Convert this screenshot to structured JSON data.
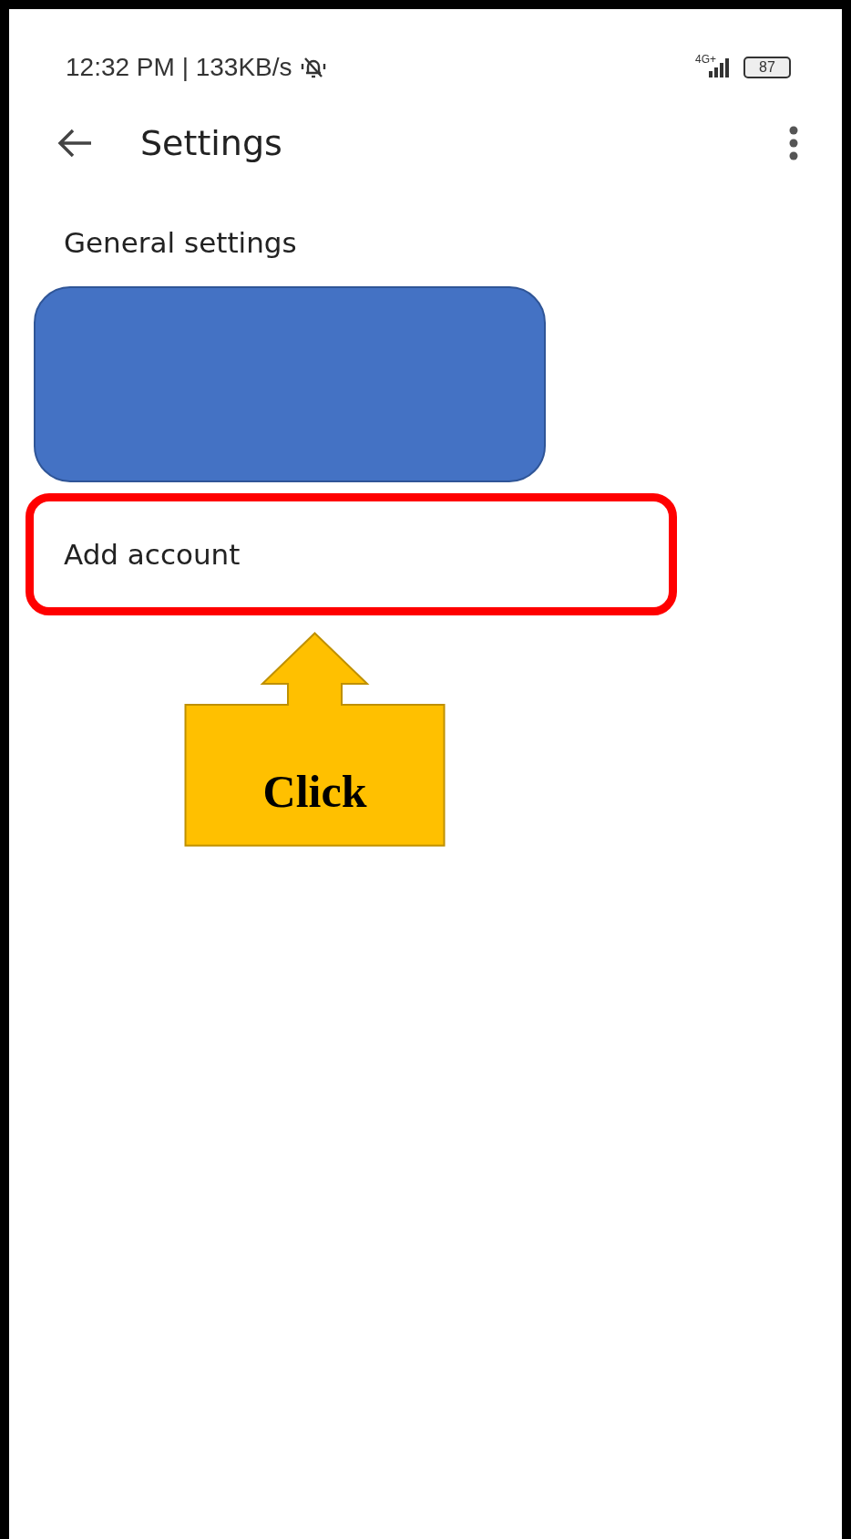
{
  "status_bar": {
    "time": "12:32 PM | 133KB/s",
    "network": "4G+",
    "battery": "87"
  },
  "app_bar": {
    "title": "Settings"
  },
  "sections": [
    {
      "kind": "item",
      "label": "General settings"
    },
    {
      "kind": "redacted"
    },
    {
      "kind": "highlighted",
      "label": "Add account"
    }
  ],
  "callout": {
    "label": "Click"
  }
}
